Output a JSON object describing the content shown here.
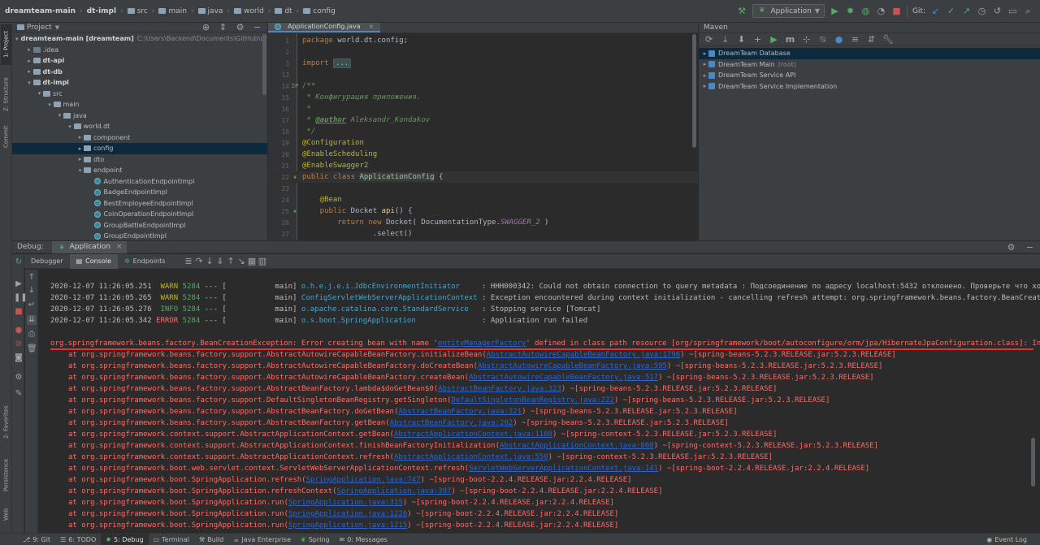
{
  "navbar": {
    "crumbs": [
      "dreamteam-main",
      "dt-impl",
      "src",
      "main",
      "java",
      "world",
      "dt",
      "config"
    ],
    "run_config": "Application",
    "git_label": "Git:"
  },
  "left_strip": {
    "tabs": [
      "1: Project",
      "Z: Structure",
      "Commit",
      "2: Favorites",
      "Persistence",
      "Web"
    ]
  },
  "project": {
    "title": "Project",
    "rows": [
      {
        "level": 0,
        "arrow": "▾",
        "label": "dreamteam-main [dreamteam]",
        "extra": "C:\\Users\\Backend\\Documents\\GitHub\\dreamteam",
        "bold": true,
        "type": "folder"
      },
      {
        "level": 1,
        "arrow": "▸",
        "label": ".idea",
        "extra": "",
        "bold": false,
        "type": "folder-dark"
      },
      {
        "level": 1,
        "arrow": "▸",
        "label": "dt-api",
        "extra": "",
        "bold": true,
        "type": "folder"
      },
      {
        "level": 1,
        "arrow": "▸",
        "label": "dt-db",
        "extra": "",
        "bold": true,
        "type": "folder"
      },
      {
        "level": 1,
        "arrow": "▾",
        "label": "dt-impl",
        "extra": "",
        "bold": true,
        "type": "folder"
      },
      {
        "level": 2,
        "arrow": "▾",
        "label": "src",
        "extra": "",
        "bold": false,
        "type": "folder"
      },
      {
        "level": 3,
        "arrow": "▾",
        "label": "main",
        "extra": "",
        "bold": false,
        "type": "folder"
      },
      {
        "level": 4,
        "arrow": "▾",
        "label": "java",
        "extra": "",
        "bold": false,
        "type": "folder"
      },
      {
        "level": 5,
        "arrow": "▾",
        "label": "world.dt",
        "extra": "",
        "bold": false,
        "type": "folder"
      },
      {
        "level": 6,
        "arrow": "▸",
        "label": "component",
        "extra": "",
        "bold": false,
        "type": "folder"
      },
      {
        "level": 6,
        "arrow": "▸",
        "label": "config",
        "extra": "",
        "bold": false,
        "type": "folder",
        "selected": true
      },
      {
        "level": 6,
        "arrow": "▸",
        "label": "dto",
        "extra": "",
        "bold": false,
        "type": "folder"
      },
      {
        "level": 6,
        "arrow": "▾",
        "label": "endpoint",
        "extra": "",
        "bold": false,
        "type": "folder"
      },
      {
        "level": 7,
        "arrow": "",
        "label": "AuthenticationEndpointImpl",
        "extra": "",
        "bold": false,
        "type": "class"
      },
      {
        "level": 7,
        "arrow": "",
        "label": "BadgeEndpointImpl",
        "extra": "",
        "bold": false,
        "type": "class"
      },
      {
        "level": 7,
        "arrow": "",
        "label": "BestEmployeeEndpointImpl",
        "extra": "",
        "bold": false,
        "type": "class"
      },
      {
        "level": 7,
        "arrow": "",
        "label": "CoinOperationEndpointImpl",
        "extra": "",
        "bold": false,
        "type": "class"
      },
      {
        "level": 7,
        "arrow": "",
        "label": "GroupBattleEndpointImpl",
        "extra": "",
        "bold": false,
        "type": "class"
      },
      {
        "level": 7,
        "arrow": "",
        "label": "GroupEndpointImpl",
        "extra": "",
        "bold": false,
        "type": "class"
      }
    ]
  },
  "editor": {
    "tab": "ApplicationConfig.java",
    "lines": [
      {
        "n": "1",
        "segs": [
          [
            "kw",
            "package "
          ],
          [
            "",
            "world.dt.config;"
          ]
        ]
      },
      {
        "n": "2",
        "segs": []
      },
      {
        "n": "3",
        "segs": [
          [
            "kw",
            "import "
          ],
          [
            "fold",
            "..."
          ]
        ]
      },
      {
        "n": "13",
        "segs": []
      },
      {
        "n": "14",
        "segs": [
          [
            "doc",
            "/**"
          ]
        ]
      },
      {
        "n": "15",
        "segs": [
          [
            "doc",
            " * Конфигурация приложения."
          ]
        ]
      },
      {
        "n": "16",
        "segs": [
          [
            "doc",
            " *"
          ]
        ]
      },
      {
        "n": "17",
        "segs": [
          [
            "doc",
            " * "
          ],
          [
            "doctag",
            "@author"
          ],
          [
            "doc",
            " Aleksandr_Kondakov"
          ]
        ]
      },
      {
        "n": "18",
        "segs": [
          [
            "doc",
            " */"
          ]
        ]
      },
      {
        "n": "19",
        "segs": [
          [
            "ann",
            "@Configuration"
          ]
        ]
      },
      {
        "n": "20",
        "segs": [
          [
            "ann",
            "@EnableScheduling"
          ]
        ]
      },
      {
        "n": "21",
        "segs": [
          [
            "ann",
            "@EnableSwagger2"
          ]
        ]
      },
      {
        "n": "22",
        "segs": [
          [
            "kw",
            "public class "
          ],
          [
            "classname",
            "ApplicationConfig"
          ],
          [
            "",
            " {"
          ]
        ],
        "current": true
      },
      {
        "n": "23",
        "segs": []
      },
      {
        "n": "24",
        "segs": [
          [
            "ann",
            "    @Bean"
          ]
        ]
      },
      {
        "n": "25",
        "segs": [
          [
            "kw",
            "    public "
          ],
          [
            "",
            "Docket "
          ],
          [
            "fn",
            "api"
          ],
          [
            "",
            "() {"
          ]
        ]
      },
      {
        "n": "26",
        "segs": [
          [
            "kw",
            "        return new "
          ],
          [
            "",
            "Docket( DocumentationType."
          ],
          [
            "const",
            "SWAGGER_2"
          ],
          [
            "",
            " )"
          ]
        ]
      },
      {
        "n": "27",
        "segs": [
          [
            "",
            "                .select()"
          ]
        ]
      }
    ]
  },
  "maven": {
    "title": "Maven",
    "items": [
      {
        "label": "DreamTeam Database",
        "extra": "",
        "selected": true
      },
      {
        "label": "DreamTeam Main",
        "extra": "(root)",
        "selected": false
      },
      {
        "label": "DreamTeam Service API",
        "extra": "",
        "selected": false
      },
      {
        "label": "DreamTeam Service Implementation",
        "extra": "",
        "selected": false
      }
    ]
  },
  "debug": {
    "title": "Debug:",
    "run_tab": "Application",
    "subtabs": [
      "Debugger",
      "Console",
      "Endpoints"
    ],
    "log_lines": [
      {
        "ts": "2020-12-07 11:26:05.251",
        "level": "WARN",
        "pid": "5284",
        "thread": "main",
        "logger": "o.h.e.j.e.i.JdbcEnvironmentInitiator    ",
        "msg": "HHH000342: Could not obtain connection to query metadata : Подсоединение по адресу localhost:5432 отклонено. Проверьте что хос"
      },
      {
        "ts": "2020-12-07 11:26:05.265",
        "level": "WARN",
        "pid": "5284",
        "thread": "main",
        "logger": "ConfigServletWebServerApplicationContext",
        "msg": "Exception encountered during context initialization - cancelling refresh attempt: org.springframework.beans.factory.BeanCreati"
      },
      {
        "ts": "2020-12-07 11:26:05.276",
        "level": "INFO",
        "pid": "5284",
        "thread": "main",
        "logger": "o.apache.catalina.core.StandardService  ",
        "msg": "Stopping service [Tomcat]"
      },
      {
        "ts": "2020-12-07 11:26:05.342",
        "level": "ERROR",
        "pid": "5284",
        "thread": "main",
        "logger": "o.s.boot.SpringApplication              ",
        "msg": "Application run failed"
      }
    ],
    "exception": {
      "prefix": "org.springframework.beans.factory.BeanCreationException: Error creating bean with name '",
      "link": "entityManagerFactory",
      "suffix": "' defined in class path resource [org/springframework/boot/autoconfigure/orm/jpa/HibernateJpaConfiguration.class]: Inv"
    },
    "stack": [
      {
        "pre": "at org.springframework.beans.factory.support.AbstractAutowireCapableBeanFactory.initializeBean(",
        "link": "AbstractAutowireCapableBeanFactory.java:1796",
        "post": ") ~[spring-beans-5.2.3.RELEASE.jar:5.2.3.RELEASE]"
      },
      {
        "pre": "at org.springframework.beans.factory.support.AbstractAutowireCapableBeanFactory.doCreateBean(",
        "link": "AbstractAutowireCapableBeanFactory.java:595",
        "post": ") ~[spring-beans-5.2.3.RELEASE.jar:5.2.3.RELEASE]"
      },
      {
        "pre": "at org.springframework.beans.factory.support.AbstractAutowireCapableBeanFactory.createBean(",
        "link": "AbstractAutowireCapableBeanFactory.java:517",
        "post": ") ~[spring-beans-5.2.3.RELEASE.jar:5.2.3.RELEASE]"
      },
      {
        "pre": "at org.springframework.beans.factory.support.AbstractBeanFactory.lambda$doGetBean$0(",
        "link": "AbstractBeanFactory.java:323",
        "post": ") ~[spring-beans-5.2.3.RELEASE.jar:5.2.3.RELEASE]"
      },
      {
        "pre": "at org.springframework.beans.factory.support.DefaultSingletonBeanRegistry.getSingleton(",
        "link": "DefaultSingletonBeanRegistry.java:222",
        "post": ") ~[spring-beans-5.2.3.RELEASE.jar:5.2.3.RELEASE]"
      },
      {
        "pre": "at org.springframework.beans.factory.support.AbstractBeanFactory.doGetBean(",
        "link": "AbstractBeanFactory.java:321",
        "post": ") ~[spring-beans-5.2.3.RELEASE.jar:5.2.3.RELEASE]"
      },
      {
        "pre": "at org.springframework.beans.factory.support.AbstractBeanFactory.getBean(",
        "link": "AbstractBeanFactory.java:202",
        "post": ") ~[spring-beans-5.2.3.RELEASE.jar:5.2.3.RELEASE]"
      },
      {
        "pre": "at org.springframework.context.support.AbstractApplicationContext.getBean(",
        "link": "AbstractApplicationContext.java:1108",
        "post": ") ~[spring-context-5.2.3.RELEASE.jar:5.2.3.RELEASE]"
      },
      {
        "pre": "at org.springframework.context.support.AbstractApplicationContext.finishBeanFactoryInitialization(",
        "link": "AbstractApplicationContext.java:868",
        "post": ") ~[spring-context-5.2.3.RELEASE.jar:5.2.3.RELEASE]"
      },
      {
        "pre": "at org.springframework.context.support.AbstractApplicationContext.refresh(",
        "link": "AbstractApplicationContext.java:550",
        "post": ") ~[spring-context-5.2.3.RELEASE.jar:5.2.3.RELEASE]"
      },
      {
        "pre": "at org.springframework.boot.web.servlet.context.ServletWebServerApplicationContext.refresh(",
        "link": "ServletWebServerApplicationContext.java:141",
        "post": ") ~[spring-boot-2.2.4.RELEASE.jar:2.2.4.RELEASE]"
      },
      {
        "pre": "at org.springframework.boot.SpringApplication.refresh(",
        "link": "SpringApplication.java:747",
        "post": ") ~[spring-boot-2.2.4.RELEASE.jar:2.2.4.RELEASE]"
      },
      {
        "pre": "at org.springframework.boot.SpringApplication.refreshContext(",
        "link": "SpringApplication.java:397",
        "post": ") ~[spring-boot-2.2.4.RELEASE.jar:2.2.4.RELEASE]"
      },
      {
        "pre": "at org.springframework.boot.SpringApplication.run(",
        "link": "SpringApplication.java:315",
        "post": ") ~[spring-boot-2.2.4.RELEASE.jar:2.2.4.RELEASE]"
      },
      {
        "pre": "at org.springframework.boot.SpringApplication.run(",
        "link": "SpringApplication.java:1226",
        "post": ") ~[spring-boot-2.2.4.RELEASE.jar:2.2.4.RELEASE]"
      },
      {
        "pre": "at org.springframework.boot.SpringApplication.run(",
        "link": "SpringApplication.java:1215",
        "post": ") ~[spring-boot-2.2.4.RELEASE.jar:2.2.4.RELEASE]"
      }
    ]
  },
  "bottombar": {
    "tabs": [
      {
        "label": "9: Git",
        "active": false
      },
      {
        "label": "6: TODO",
        "active": false
      },
      {
        "label": "5: Debug",
        "active": true
      },
      {
        "label": "Terminal",
        "active": false
      },
      {
        "label": "Build",
        "active": false
      },
      {
        "label": "Java Enterprise",
        "active": false
      },
      {
        "label": "Spring",
        "active": false
      },
      {
        "label": "0: Messages",
        "active": false
      }
    ],
    "event_log": "Event Log"
  }
}
